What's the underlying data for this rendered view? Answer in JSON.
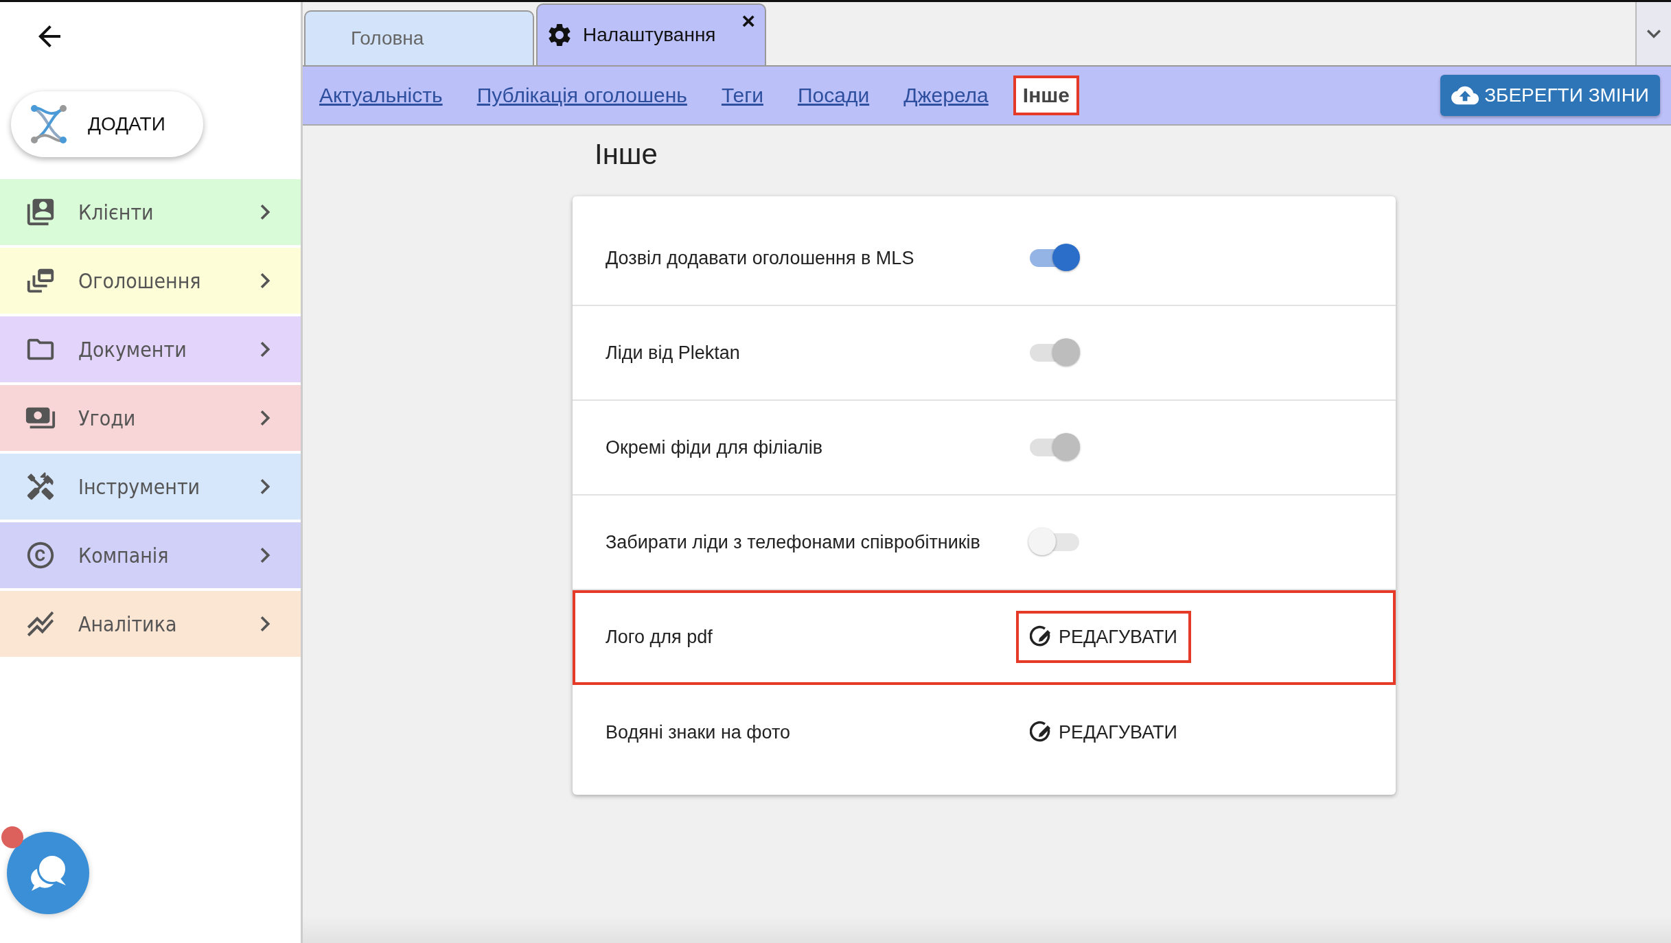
{
  "sidebar": {
    "add_button": {
      "label": "ДОДАТИ"
    },
    "items": [
      {
        "label": "Клієнти",
        "color": "#dafbd8"
      },
      {
        "label": "Оголошення",
        "color": "#fdfdd8"
      },
      {
        "label": "Документи",
        "color": "#e3d4fb"
      },
      {
        "label": "Угоди",
        "color": "#f8d5d6"
      },
      {
        "label": "Інструменти",
        "color": "#d6e6fb"
      },
      {
        "label": "Компанія",
        "color": "#d0d0f8"
      },
      {
        "label": "Аналітика",
        "color": "#fbe5d3"
      }
    ],
    "chat": {
      "notification": true
    }
  },
  "tabs": [
    {
      "label": "Головна",
      "selected": false
    },
    {
      "label": "Налаштування",
      "selected": true,
      "close": "×"
    }
  ],
  "subnav": {
    "links": [
      {
        "label": "Актуальність",
        "selected": false,
        "highlighted": false
      },
      {
        "label": "Публікація оголошень",
        "selected": false,
        "highlighted": false
      },
      {
        "label": "Теги",
        "selected": false,
        "highlighted": false
      },
      {
        "label": "Посади",
        "selected": false,
        "highlighted": false
      },
      {
        "label": "Джерела",
        "selected": false,
        "highlighted": false
      },
      {
        "label": "Інше",
        "selected": true,
        "highlighted": true
      }
    ],
    "save_button": {
      "label": "ЗБЕРЕГТИ ЗМІНИ"
    }
  },
  "page_title": "Інше",
  "settings": [
    {
      "label": "Дозвіл додавати оголошення в MLS",
      "kind": "toggle",
      "on": true,
      "disabled": false,
      "highlighted": false
    },
    {
      "label": "Ліди від Plektan",
      "kind": "toggle",
      "on": true,
      "disabled": true,
      "highlighted": false
    },
    {
      "label": "Окремі фіди для філіалів",
      "kind": "toggle",
      "on": true,
      "disabled": true,
      "highlighted": false
    },
    {
      "label": "Забирати ліди з телефонами співробітників",
      "kind": "toggle",
      "on": false,
      "disabled": false,
      "highlighted": false
    },
    {
      "label": "Лого для pdf",
      "kind": "action",
      "action": "РЕДАГУВАТИ",
      "highlighted": true
    },
    {
      "label": "Водяні знаки на фото",
      "kind": "action",
      "action": "РЕДАГУВАТИ",
      "highlighted": false
    }
  ]
}
